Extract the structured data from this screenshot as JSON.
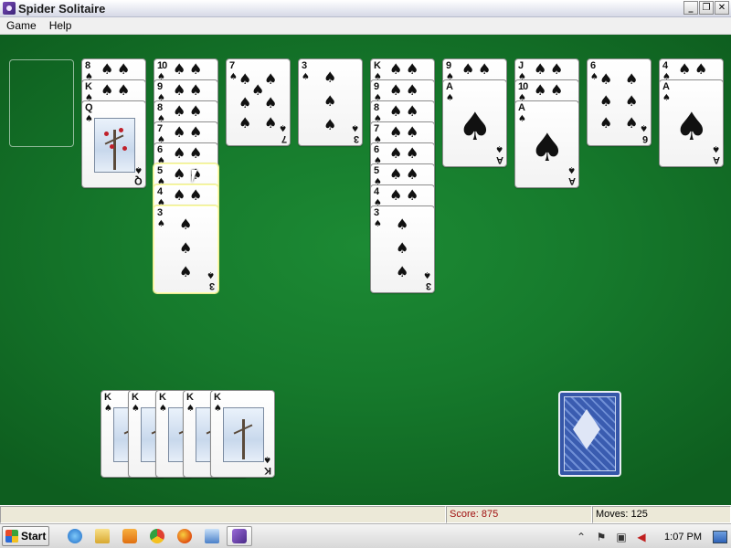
{
  "window": {
    "title": "Spider Solitaire",
    "buttons": [
      "_",
      "❐",
      "✕"
    ]
  },
  "menu": [
    "Game",
    "Help"
  ],
  "tableau": {
    "empty_slots": 1,
    "columns": [
      {
        "cards": [
          {
            "r": "8",
            "fd": false
          },
          {
            "r": "K",
            "fd": false
          },
          {
            "r": "Q",
            "fd": false,
            "top": true,
            "face": true
          }
        ]
      },
      {
        "cards": [
          {
            "r": "10"
          },
          {
            "r": "9"
          },
          {
            "r": "8"
          },
          {
            "r": "7"
          },
          {
            "r": "6"
          },
          {
            "r": "5",
            "sel": true
          },
          {
            "r": "4",
            "sel": true
          },
          {
            "r": "3",
            "top": true,
            "sel": true
          }
        ]
      },
      {
        "cards": [
          {
            "r": "7",
            "top": true
          }
        ]
      },
      {
        "cards": [
          {
            "r": "3",
            "top": true
          }
        ]
      },
      {
        "cards": [
          {
            "r": "K"
          },
          {
            "r": "9"
          },
          {
            "r": "8"
          },
          {
            "r": "7"
          },
          {
            "r": "6"
          },
          {
            "r": "5"
          },
          {
            "r": "4"
          },
          {
            "r": "3",
            "top": true
          }
        ]
      },
      {
        "cards": [
          {
            "r": "9"
          },
          {
            "r": "A",
            "top": true,
            "ace": true
          }
        ]
      },
      {
        "cards": [
          {
            "r": "J"
          },
          {
            "r": "10"
          },
          {
            "r": "A",
            "top": true,
            "ace": true
          }
        ]
      },
      {
        "cards": [
          {
            "r": "6",
            "top": true
          }
        ]
      },
      {
        "cards": [
          {
            "r": "4"
          },
          {
            "r": "A",
            "top": true,
            "ace": true
          }
        ]
      }
    ],
    "suit": "♠"
  },
  "completed": {
    "count": 5,
    "rank": "K"
  },
  "stock": {
    "label": "stock"
  },
  "status": {
    "left": "",
    "score": "Score: 875",
    "moves": "Moves:  125"
  },
  "taskbar": {
    "start": "Start",
    "clock": "1:07 PM"
  }
}
